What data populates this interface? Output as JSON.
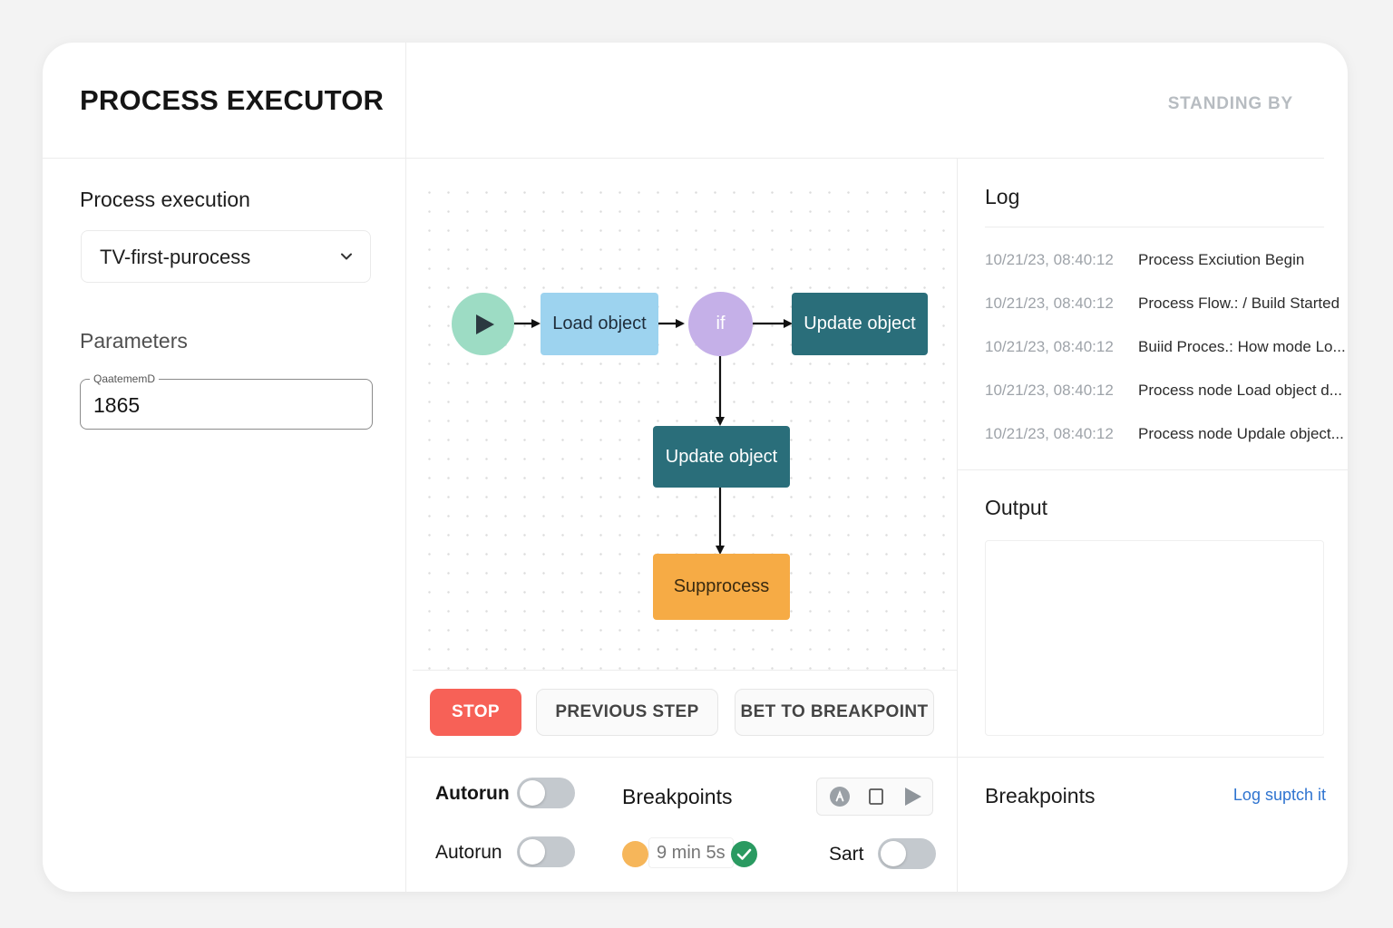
{
  "header": {
    "title": "PROCESS EXECUTOR",
    "status": "STANDING BY"
  },
  "sidebar": {
    "execution_title": "Process execution",
    "process_select": {
      "value": "TV-first-purocess",
      "icon": "chevron-down-icon"
    },
    "parameters_title": "Parameters",
    "param_field": {
      "label": "QaatememD",
      "value": "1865"
    }
  },
  "flow": {
    "nodes": [
      {
        "id": "start",
        "type": "start",
        "label": "",
        "icon": "play-icon",
        "color": "#9ddcc4"
      },
      {
        "id": "load",
        "type": "action",
        "label": "Load object",
        "color": "#9dd3ef"
      },
      {
        "id": "if",
        "type": "condition",
        "label": "if",
        "color": "#c5b0e8"
      },
      {
        "id": "update1",
        "type": "action",
        "label": "Update object",
        "color": "#2a6e7a"
      },
      {
        "id": "update2",
        "type": "action",
        "label": "Update object",
        "color": "#2a6e7a"
      },
      {
        "id": "sub",
        "type": "action",
        "label": "Supprocess",
        "color": "#f6ab45"
      }
    ],
    "edges": [
      [
        "start",
        "load"
      ],
      [
        "load",
        "if"
      ],
      [
        "if",
        "update1"
      ],
      [
        "if",
        "update2"
      ],
      [
        "update2",
        "sub"
      ]
    ]
  },
  "actions": {
    "stop": "STOP",
    "previous": "PREVIOUS STEP",
    "breakpoint": "BET TO BREAKPOINT"
  },
  "controls": {
    "autorun1_label": "Autorun",
    "autorun1_on": false,
    "autorun2_label": "Autorun",
    "autorun2_on": false,
    "breakpoints_label": "Breakpoints",
    "playback_icons": [
      "cursor-icon",
      "stop-icon",
      "play-icon"
    ],
    "time": "9 min 5s",
    "sart_label": "Sart",
    "sart_on": false
  },
  "log": {
    "title": "Log",
    "entries": [
      {
        "time": "10/21/23, 08:40:12",
        "message": "Process Exciution Begin"
      },
      {
        "time": "10/21/23, 08:40:12",
        "message": "Process Flow.: / Build Started"
      },
      {
        "time": "10/21/23, 08:40:12",
        "message": "Buiid Proces.: How mode Lo..."
      },
      {
        "time": "10/21/23, 08:40:12",
        "message": "Process node Load object d..."
      },
      {
        "time": "10/21/23, 08:40:12",
        "message": "Process node Updale object..."
      }
    ]
  },
  "output": {
    "title": "Output"
  },
  "breakpoints_panel": {
    "title": "Breakpoints",
    "link": "Log suptch it"
  },
  "colors": {
    "stop": "#f76157",
    "link": "#2f74d0",
    "status": "#b7bcc1",
    "toggle_off": "#c4c9ce",
    "success": "#2a9a61",
    "pending": "#f6b65a"
  }
}
